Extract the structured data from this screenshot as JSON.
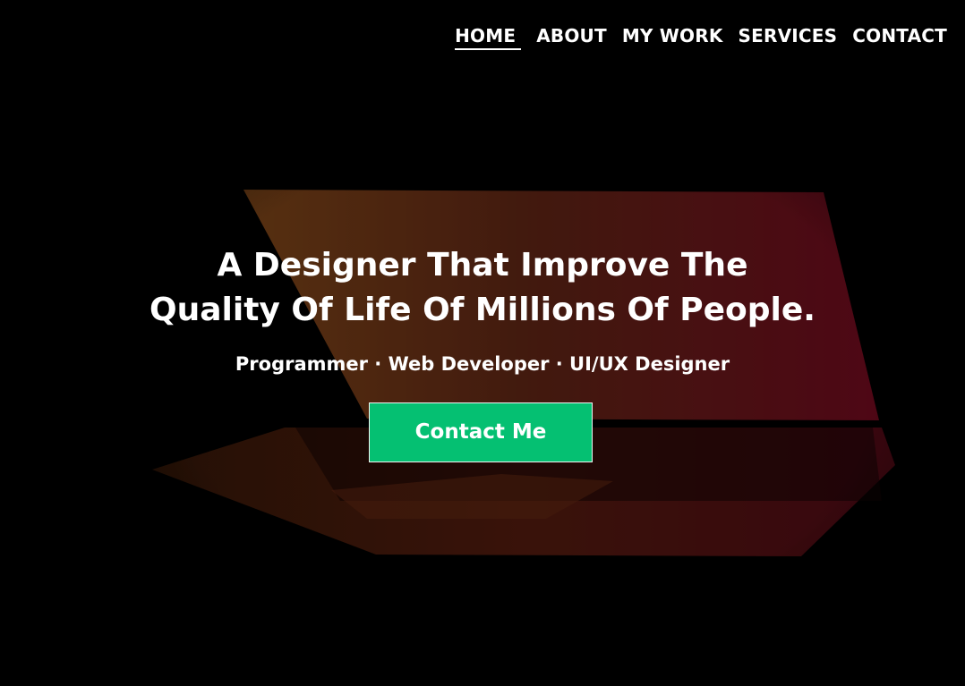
{
  "nav": {
    "items": [
      {
        "label": "HOME",
        "active": true
      },
      {
        "label": "ABOUT",
        "active": false
      },
      {
        "label": "MY WORK",
        "active": false
      },
      {
        "label": "SERVICES",
        "active": false
      },
      {
        "label": "CONTACT",
        "active": false
      }
    ]
  },
  "hero": {
    "headline_line1": "A Designer That Improve The",
    "headline_line2": "Quality Of Life Of Millions Of People.",
    "tagline": "Programmer · Web Developer · UI/UX Designer",
    "cta_label": "Contact Me",
    "background_image": "laptop-photo"
  },
  "colors": {
    "cta_background": "#05c072",
    "overlay_orange": "#8a4a1c",
    "overlay_red": "#6a0a20",
    "text": "#ffffff"
  }
}
